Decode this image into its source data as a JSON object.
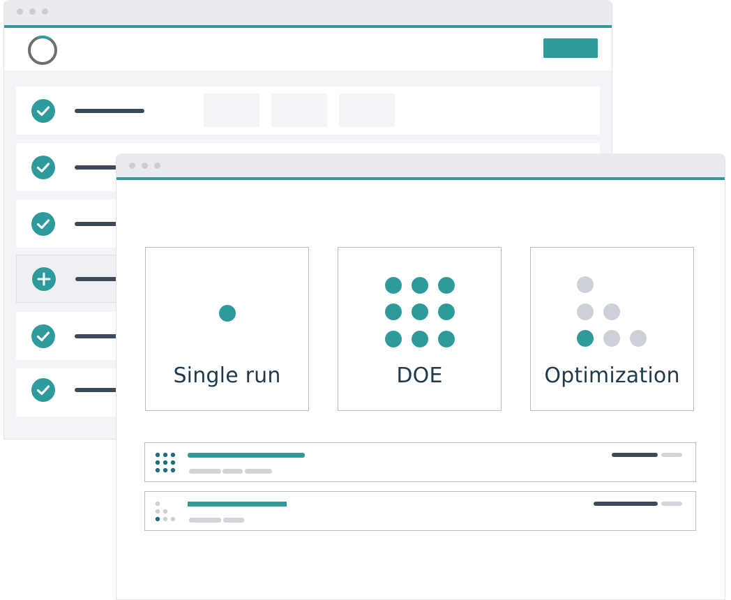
{
  "colors": {
    "accent": "#2d9a9c",
    "dark_text": "#1e3a4c",
    "bar_dark": "#3d4a57",
    "inactive_dot": "#cdd1d7",
    "chrome": "#e9ebee"
  },
  "back_window": {
    "logo_icon": "progress-ring-icon",
    "rows": [
      {
        "icon": "check-circle-icon"
      },
      {
        "icon": "check-circle-icon"
      },
      {
        "icon": "check-circle-icon"
      },
      {
        "icon": "plus-circle-icon"
      },
      {
        "icon": "check-circle-icon"
      },
      {
        "icon": "check-circle-icon"
      }
    ]
  },
  "front_window": {
    "cards": [
      {
        "label": "Single run",
        "icon": "single-dot-icon"
      },
      {
        "label": "DOE",
        "icon": "dot-grid-icon"
      },
      {
        "label": "Optimization",
        "icon": "dot-triangle-icon"
      }
    ],
    "list_items": [
      {
        "icon": "dot-grid-icon"
      },
      {
        "icon": "dot-triangle-icon"
      }
    ]
  }
}
